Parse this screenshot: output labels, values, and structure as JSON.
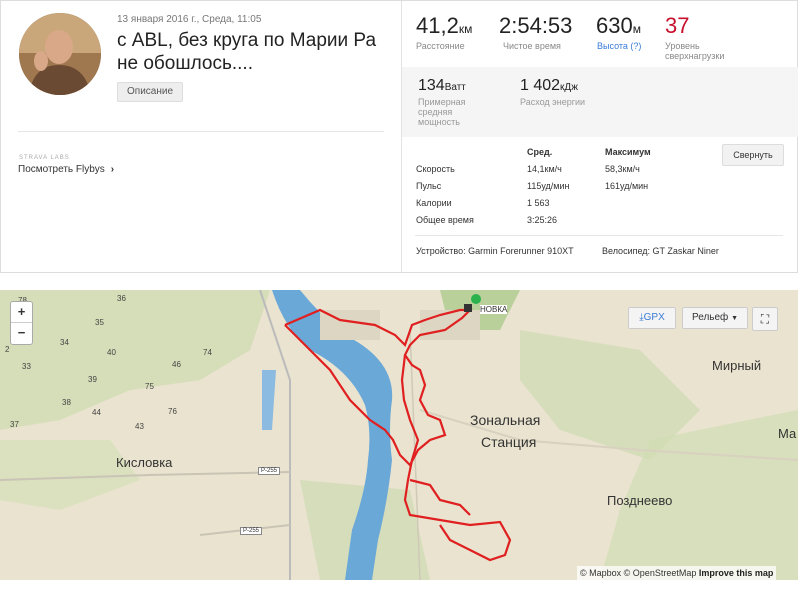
{
  "activity": {
    "date": "13 января 2016 г., Среда, 11:05",
    "title": "с ABL, без круга по Марии Ра не обошлось....",
    "description_button": "Описание",
    "strava_labs": "STRAVA LABS",
    "flybys_link": "Посмотреть Flybys",
    "flybys_chevron": "›"
  },
  "stats": {
    "distance": {
      "value": "41,2",
      "unit": "км",
      "label": "Расстояние"
    },
    "moving_time": {
      "value": "2:54:53",
      "label": "Чистое время"
    },
    "elevation": {
      "value": "630",
      "unit": "м",
      "label": "Высота (?)"
    },
    "suffer": {
      "value": "37",
      "label1": "Уровень",
      "label2": "сверхнагрузки"
    },
    "power": {
      "value": "134",
      "unit": "Ватт",
      "label1": "Примерная",
      "label2": "средняя",
      "label3": "мощность"
    },
    "energy": {
      "value": "1 402",
      "unit": "кДж",
      "label": "Расход энергии"
    }
  },
  "table": {
    "header_avg": "Сред.",
    "header_max": "Максимум",
    "collapse_button": "Свернуть",
    "rows": [
      {
        "label": "Скорость",
        "avg": "14,1км/ч",
        "max": "58,3км/ч"
      },
      {
        "label": "Пульс",
        "avg": "115уд/мин",
        "max": "161уд/мин"
      },
      {
        "label": "Калории",
        "avg": "1 563",
        "max": ""
      },
      {
        "label": "Общее время",
        "avg": "3:25:26",
        "max": ""
      }
    ],
    "device": "Устройство: Garmin Forerunner 910XT",
    "bike": "Велосипед: GT Zaskar Niner"
  },
  "map": {
    "zoom_in": "+",
    "zoom_out": "−",
    "gpx_button": "GPX",
    "relief_button": "Рельеф",
    "relief_caret": "▼",
    "fullscreen_icon": "⛶",
    "attribution_mapbox": "© Mapbox",
    "attribution_osm": "© OpenStreetMap",
    "attribution_improve": "Improve this map",
    "places": {
      "kislovka": "Кисловка",
      "zonal1": "Зональная",
      "zonal2": "Станция",
      "mirny": "Мирный",
      "pozdneevo": "Позднеево",
      "ma": "Ма",
      "novka": "НОВКА"
    },
    "road_labels": [
      "Р-255",
      "Р-255"
    ],
    "numbers": [
      "36",
      "35",
      "34",
      "33",
      "38",
      "40",
      "39",
      "37",
      "44",
      "43",
      "46",
      "74",
      "75",
      "76",
      "78",
      "2"
    ],
    "route_color": "#e02020",
    "water_color": "#6aa8d8"
  }
}
